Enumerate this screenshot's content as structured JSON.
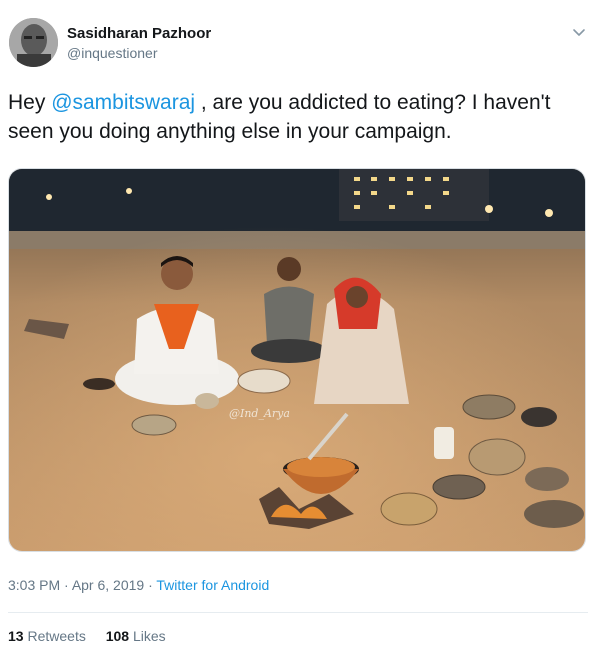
{
  "user": {
    "name": "Sasidharan Pazhoor",
    "handle": "@inquestioner"
  },
  "tweet": {
    "prefix": "Hey ",
    "mention": "@sambitswaraj",
    "suffix": " , are you addicted to eating? I haven't seen you doing anything else in your campaign."
  },
  "photo": {
    "watermark": "@Ind_Arya"
  },
  "meta": {
    "time": "3:03 PM",
    "sep1": " · ",
    "date": "Apr 6, 2019",
    "sep2": " · ",
    "source": "Twitter for Android"
  },
  "stats": {
    "retweets_count": "13",
    "retweets_label": "Retweets",
    "likes_count": "108",
    "likes_label": "Likes"
  },
  "icons": {
    "menu": "chevron-down-icon"
  },
  "colors": {
    "link": "#1b95e0",
    "secondary_text": "#657786",
    "text": "#14171a"
  }
}
